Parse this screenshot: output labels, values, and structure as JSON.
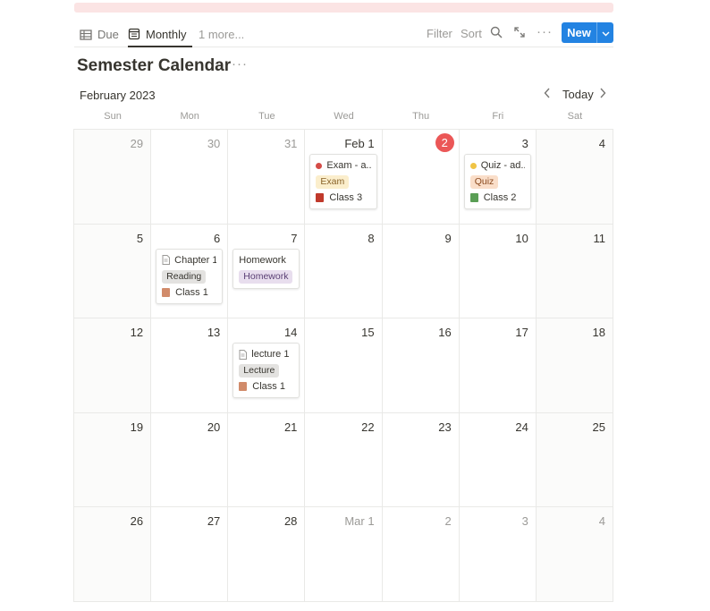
{
  "toolbar": {
    "tabs": [
      {
        "label": "Due",
        "icon": "table-icon"
      },
      {
        "label": "Monthly",
        "icon": "calendar-icon",
        "active": true
      },
      {
        "label": "1 more..."
      }
    ],
    "filter_label": "Filter",
    "sort_label": "Sort",
    "more_dots": "···",
    "new_label": "New",
    "new_chevron": "⌄"
  },
  "page": {
    "title": "Semester Calendar",
    "title_dots": "···"
  },
  "calendar": {
    "month_label": "February 2023",
    "prev": "‹",
    "today_label": "Today",
    "next": "›",
    "weekdays": [
      "Sun",
      "Mon",
      "Tue",
      "Wed",
      "Thu",
      "Fri",
      "Sat"
    ],
    "colors": {
      "exam_dot": "#d44c47",
      "quiz_dot": "#f0c445",
      "today": "#eb5757",
      "new_button": "#2383e2"
    },
    "days": [
      {
        "label": "29",
        "other": true
      },
      {
        "label": "30",
        "other": true
      },
      {
        "label": "31",
        "other": true
      },
      {
        "label": "Feb 1",
        "event": {
          "title": "Exam - a...",
          "dot": "#d44c47",
          "tag": "Exam",
          "tag_bg": "#fbeecc",
          "tag_fg": "#89632a",
          "class": "Class 3",
          "book": "#c0392b"
        }
      },
      {
        "label": "2",
        "today": true
      },
      {
        "label": "3",
        "event": {
          "title": "Quiz - ad...",
          "dot": "#f0c445",
          "tag": "Quiz",
          "tag_bg": "#fadec9",
          "tag_fg": "#8b4a1f",
          "class": "Class 2",
          "book": "#5a9e55"
        }
      },
      {
        "label": "4"
      },
      {
        "label": "5"
      },
      {
        "label": "6",
        "event": {
          "title": "Chapter 1...",
          "doc": true,
          "tag": "Reading",
          "tag_bg": "#e3e2e0",
          "tag_fg": "#37352f",
          "class": "Class 1",
          "book": "#d18b6a"
        }
      },
      {
        "label": "7",
        "event": {
          "title": "Homework",
          "tag": "Homework",
          "tag_bg": "#e8deee",
          "tag_fg": "#5a3f74"
        }
      },
      {
        "label": "8"
      },
      {
        "label": "9"
      },
      {
        "label": "10"
      },
      {
        "label": "11"
      },
      {
        "label": "12"
      },
      {
        "label": "13"
      },
      {
        "label": "14",
        "event": {
          "title": "lecture 1",
          "doc": true,
          "tag": "Lecture",
          "tag_bg": "#e3e2e0",
          "tag_fg": "#37352f",
          "class": "Class 1",
          "book": "#d18b6a"
        }
      },
      {
        "label": "15"
      },
      {
        "label": "16"
      },
      {
        "label": "17"
      },
      {
        "label": "18"
      },
      {
        "label": "19"
      },
      {
        "label": "20"
      },
      {
        "label": "21"
      },
      {
        "label": "22"
      },
      {
        "label": "23"
      },
      {
        "label": "24"
      },
      {
        "label": "25"
      },
      {
        "label": "26"
      },
      {
        "label": "27"
      },
      {
        "label": "28"
      },
      {
        "label": "Mar 1",
        "other": true
      },
      {
        "label": "2",
        "other": true
      },
      {
        "label": "3",
        "other": true
      },
      {
        "label": "4",
        "other": true
      }
    ]
  }
}
